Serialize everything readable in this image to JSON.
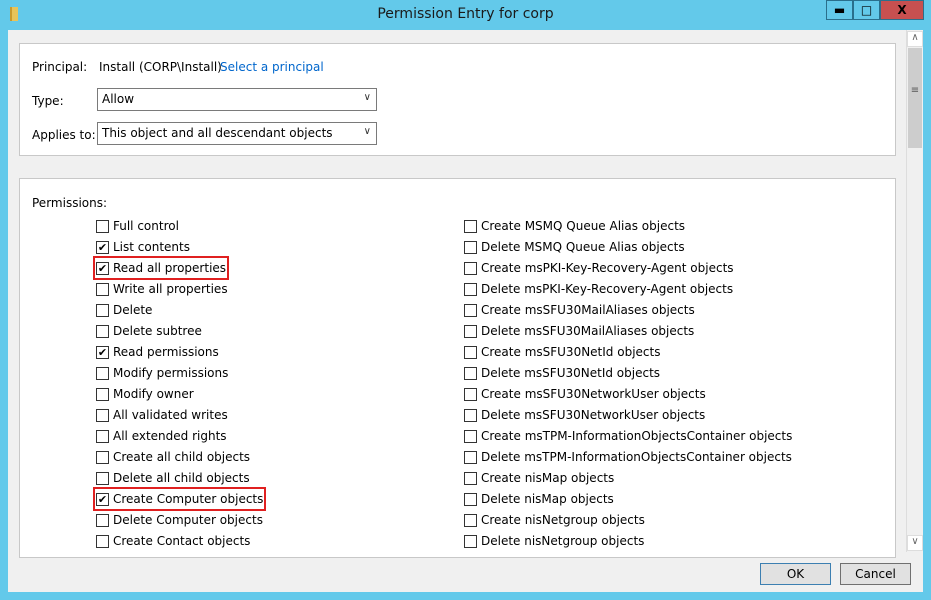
{
  "window": {
    "title": "Permission Entry for corp",
    "minimize": "▬",
    "maximize": "□",
    "close": "X"
  },
  "principal": {
    "label": "Principal:",
    "value": "Install (CORP\\Install)",
    "link": "Select a principal"
  },
  "type": {
    "label": "Type:",
    "value": "Allow"
  },
  "applies_to": {
    "label": "Applies to:",
    "value": "This object and all descendant objects"
  },
  "permissions": {
    "label": "Permissions:",
    "left": [
      {
        "label": "Full control",
        "checked": false
      },
      {
        "label": "List contents",
        "checked": true
      },
      {
        "label": "Read all properties",
        "checked": true,
        "highlighted": true
      },
      {
        "label": "Write all properties",
        "checked": false
      },
      {
        "label": "Delete",
        "checked": false
      },
      {
        "label": "Delete subtree",
        "checked": false
      },
      {
        "label": "Read permissions",
        "checked": true
      },
      {
        "label": "Modify permissions",
        "checked": false
      },
      {
        "label": "Modify owner",
        "checked": false
      },
      {
        "label": "All validated writes",
        "checked": false
      },
      {
        "label": "All extended rights",
        "checked": false
      },
      {
        "label": "Create all child objects",
        "checked": false
      },
      {
        "label": "Delete all child objects",
        "checked": false
      },
      {
        "label": "Create Computer objects",
        "checked": true,
        "highlighted": true
      },
      {
        "label": "Delete Computer objects",
        "checked": false
      },
      {
        "label": "Create Contact objects",
        "checked": false
      }
    ],
    "right": [
      {
        "label": "Create MSMQ Queue Alias objects",
        "checked": false
      },
      {
        "label": "Delete MSMQ Queue Alias objects",
        "checked": false
      },
      {
        "label": "Create msPKI-Key-Recovery-Agent objects",
        "checked": false
      },
      {
        "label": "Delete msPKI-Key-Recovery-Agent objects",
        "checked": false
      },
      {
        "label": "Create msSFU30MailAliases objects",
        "checked": false
      },
      {
        "label": "Delete msSFU30MailAliases objects",
        "checked": false
      },
      {
        "label": "Create msSFU30NetId objects",
        "checked": false
      },
      {
        "label": "Delete msSFU30NetId objects",
        "checked": false
      },
      {
        "label": "Create msSFU30NetworkUser objects",
        "checked": false
      },
      {
        "label": "Delete msSFU30NetworkUser objects",
        "checked": false
      },
      {
        "label": "Create msTPM-InformationObjectsContainer objects",
        "checked": false
      },
      {
        "label": "Delete msTPM-InformationObjectsContainer objects",
        "checked": false
      },
      {
        "label": "Create nisMap objects",
        "checked": false
      },
      {
        "label": "Delete nisMap objects",
        "checked": false
      },
      {
        "label": "Create nisNetgroup objects",
        "checked": false
      },
      {
        "label": "Delete nisNetgroup objects",
        "checked": false
      }
    ]
  },
  "buttons": {
    "ok": "OK",
    "cancel": "Cancel"
  }
}
